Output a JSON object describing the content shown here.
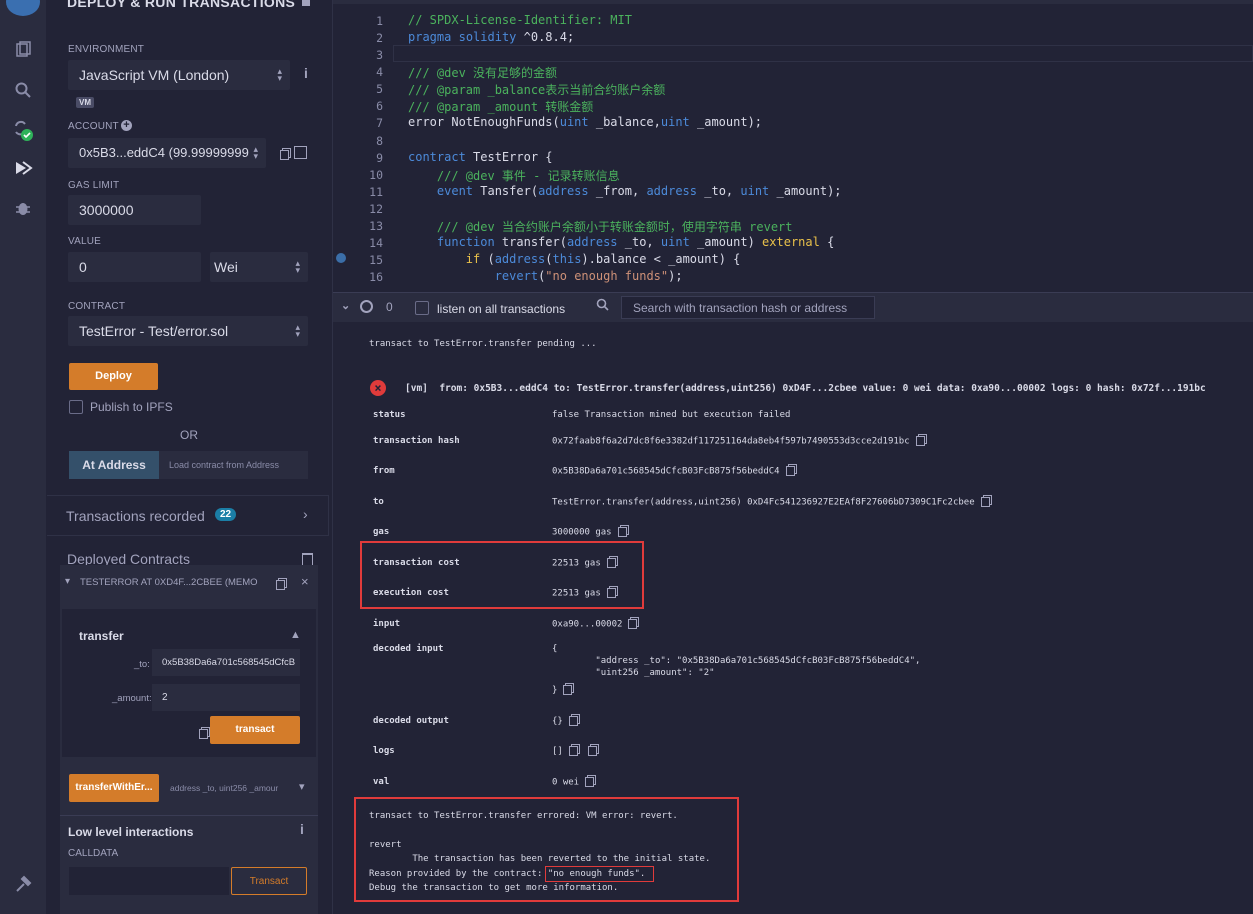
{
  "panel": {
    "title": "DEPLOY & RUN TRANSACTIONS",
    "environment_label": "ENVIRONMENT",
    "environment_value": "JavaScript VM (London)",
    "vm_badge": "VM",
    "account_label": "ACCOUNT",
    "account_value": "0x5B3...eddC4 (99.99999999",
    "gas_limit_label": "GAS LIMIT",
    "gas_limit_value": "3000000",
    "value_label": "VALUE",
    "value_amount": "0",
    "value_unit": "Wei",
    "contract_label": "CONTRACT",
    "contract_value": "TestError - Test/error.sol",
    "deploy_label": "Deploy",
    "publish_label": "Publish to IPFS",
    "or_label": "OR",
    "at_address_label": "At Address",
    "at_address_placeholder": "Load contract from Address",
    "transactions_recorded_label": "Transactions recorded",
    "transactions_recorded_count": "22",
    "deployed_contracts_label": "Deployed Contracts",
    "instance_label": "TESTERROR AT 0XD4F...2CBEE (MEMO",
    "function_name": "transfer",
    "param_to_label": "_to:",
    "param_to_value": "0x5B38Da6a701c568545dCfcB",
    "param_amount_label": "_amount:",
    "param_amount_value": "2",
    "transact_label": "transact",
    "transfer_with_error_label": "transferWithEr...",
    "transfer_with_error_params": "address _to, uint256 _amour",
    "low_level_label": "Low level interactions",
    "calldata_label": "CALLDATA",
    "calldata_transact_label": "Transact"
  },
  "editor": {
    "lines": [
      {
        "n": "1",
        "html": "<span class=\"cm\">// SPDX-License-Identifier: MIT</span>"
      },
      {
        "n": "2",
        "html": "<span class=\"kw\">pragma</span> <span class=\"kw\">solidity</span> ^0.8.4;"
      },
      {
        "n": "3",
        "html": ""
      },
      {
        "n": "4",
        "html": "<span class=\"cm\">/// @dev 没有足够的金额</span>"
      },
      {
        "n": "5",
        "html": "<span class=\"cm\">/// @param _balance表示当前合约账户余额</span>"
      },
      {
        "n": "6",
        "html": "<span class=\"cm\">/// @param _amount 转账金额</span>"
      },
      {
        "n": "7",
        "html": "error NotEnoughFunds(<span class=\"kw\">uint</span> _balance,<span class=\"kw\">uint</span> _amount);"
      },
      {
        "n": "8",
        "html": ""
      },
      {
        "n": "9",
        "html": "<span class=\"kw\">contract</span> TestError {"
      },
      {
        "n": "10",
        "html": "    <span class=\"cm\">/// @dev 事件 - 记录转账信息</span>"
      },
      {
        "n": "11",
        "html": "    <span class=\"kw\">event</span> Tansfer(<span class=\"kw\">address</span> _from, <span class=\"kw\">address</span> _to, <span class=\"kw\">uint</span> _amount);"
      },
      {
        "n": "12",
        "html": ""
      },
      {
        "n": "13",
        "html": "    <span class=\"cm\">/// @dev 当合约账户余额小于转账金额时，使用字符串 revert</span>"
      },
      {
        "n": "14",
        "html": "    <span class=\"kw\">function</span> transfer(<span class=\"kw\">address</span> _to, <span class=\"kw\">uint</span> _amount) <span class=\"kw2\">external</span> {"
      },
      {
        "n": "15",
        "html": "        <span class=\"kw2\">if</span> (<span class=\"kw\">address</span>(<span class=\"kw\">this</span>).balance &lt; _amount) {"
      },
      {
        "n": "16",
        "html": "            <span class=\"kw\">revert</span>(<span class=\"str\">\"no enough funds\"</span>);"
      }
    ]
  },
  "terminal": {
    "pending_count": "0",
    "listen_label": "listen on all transactions",
    "search_placeholder": "Search with transaction hash or address",
    "pending_line": "transact to TestError.transfer pending ...",
    "tx_summary": "[vm]  from: 0x5B3...eddC4 to: TestError.transfer(address,uint256) 0xD4F...2cbee value: 0 wei data: 0xa90...00002 logs: 0 hash: 0x72f...191bc",
    "rows": [
      {
        "key": "status",
        "value": "false Transaction mined but execution failed",
        "copy": false
      },
      {
        "key": "transaction hash",
        "value": "0x72faab8f6a2d7dc8f6e3382df117251164da8eb4f597b7490553d3cce2d191bc",
        "copy": true
      },
      {
        "key": "from",
        "value": "0x5B38Da6a701c568545dCfcB03FcB875f56beddC4",
        "copy": true
      },
      {
        "key": "to",
        "value": "TestError.transfer(address,uint256) 0xD4Fc541236927E2EAf8F27606bD7309C1Fc2cbee",
        "copy": true
      },
      {
        "key": "gas",
        "value": "3000000 gas",
        "copy": true
      },
      {
        "key": "transaction cost",
        "value": "22513 gas",
        "copy": true
      },
      {
        "key": "execution cost",
        "value": "22513 gas",
        "copy": true
      },
      {
        "key": "input",
        "value": "0xa90...00002",
        "copy": true
      }
    ],
    "decoded_input_key": "decoded input",
    "decoded_input_lines": [
      "{",
      "        \"address _to\": \"0x5B38Da6a701c568545dCfcB03FcB875f56beddC4\",",
      "        \"uint256 _amount\": \"2\"",
      "}"
    ],
    "decoded_output_key": "decoded output",
    "decoded_output_value": "{}",
    "logs_key": "logs",
    "logs_value": "[]",
    "val_key": "val",
    "val_value": "0 wei",
    "error_line1": "transact to TestError.transfer errored: VM error: revert.",
    "error_line2": "revert",
    "error_line3": "        The transaction has been reverted to the initial state.",
    "error_line4_prefix": "Reason provided by the contract: ",
    "error_reason": "\"no enough funds\".",
    "error_line5": "Debug the transaction to get more information."
  },
  "colors": {
    "accent": "#d47c2a",
    "danger": "#e03b3b",
    "info_badge": "#1b7ea6"
  }
}
